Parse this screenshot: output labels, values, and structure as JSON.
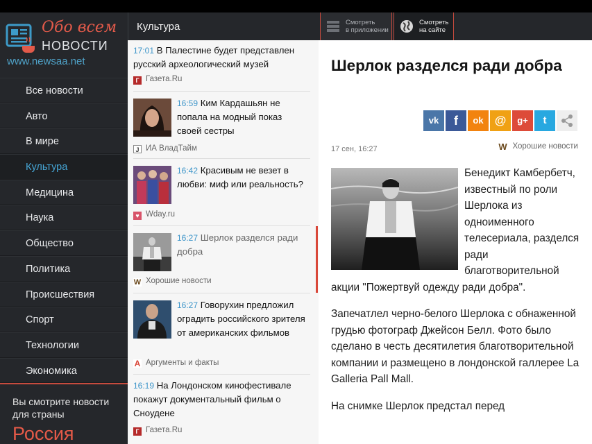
{
  "logo": {
    "line1": "Обо всем",
    "line2": "НОВОСТИ",
    "url": "www.newsaa.net"
  },
  "nav": {
    "items": [
      "Все новости",
      "Авто",
      "В мире",
      "Культура",
      "Медицина",
      "Наука",
      "Общество",
      "Политика",
      "Происшествия",
      "Спорт",
      "Технологии",
      "Экономика"
    ],
    "active": "Культура"
  },
  "country": {
    "note": "Вы смотрите новости для страны",
    "name": "Россия"
  },
  "middle": {
    "header": "Культура"
  },
  "feed": [
    {
      "time": "17:01",
      "title": "В Палестине будет представлен русский археологический музей",
      "source": "Газета.Ru",
      "source_icon": "gazeta-ru-icon",
      "thumb": false
    },
    {
      "time": "16:59",
      "title": "Ким Кардашьян не попала на модный показ своей сестры",
      "source": "ИА ВладТайм",
      "source_icon": "vladtime-icon",
      "thumb": true
    },
    {
      "time": "16:42",
      "title": "Красивым не везет в любви: миф или реальность?",
      "source": "Wday.ru",
      "source_icon": "wday-icon",
      "thumb": true
    },
    {
      "time": "16:27",
      "title": "Шерлок разделся ради добра",
      "source": "Хорошие новости",
      "source_icon": "good-news-icon",
      "thumb": true,
      "current": true
    },
    {
      "time": "16:27",
      "title": "Говорухин предложил оградить российского зрителя от американских фильмов",
      "source": "Аргументы и факты",
      "source_icon": "aif-icon",
      "thumb": true
    },
    {
      "time": "16:19",
      "title": "На Лондонском кинофестивале покажут документальный фильм о Сноудене",
      "source": "Газета.Ru",
      "source_icon": "gazeta-ru-icon",
      "thumb": false
    }
  ],
  "header_buttons": {
    "app": {
      "line1": "Смотреть",
      "line2": "в приложении"
    },
    "site": {
      "line1": "Смотреть",
      "line2": "на сайте"
    }
  },
  "article": {
    "title": "Шерлок разделся ради добра",
    "date": "17 сен, 16:27",
    "source": "Хорошие новости",
    "paragraphs": [
      "Бенедикт Камбербетч, известный по роли Шерлока из одноименного телесериала, разделся ради благотворительной акции \"Пожертвуй одежду ради добра\".",
      "Запечатлел черно-белого Шерлока с обнаженной грудью фотограф Джейсон Белл. Фото было сделано в честь десятилетия благотворительной компании и размещено в лондонской галлерее La Galleria Pall Mall.",
      "На снимке Шерлок предстал перед"
    ]
  },
  "share": [
    {
      "name": "vk",
      "label": "vk",
      "color": "#4a76a8"
    },
    {
      "name": "facebook",
      "label": "f",
      "color": "#3b5998"
    },
    {
      "name": "odnoklassniki",
      "label": "ok",
      "color": "#f2830f"
    },
    {
      "name": "mailru",
      "label": "@",
      "color": "#f0a114"
    },
    {
      "name": "googleplus",
      "label": "g+",
      "color": "#dd4b39"
    },
    {
      "name": "twitter",
      "label": "t",
      "color": "#28a8e0"
    },
    {
      "name": "share",
      "label": "<",
      "color": "#eeeeee"
    }
  ],
  "colors": {
    "accent_red": "#e25a4a",
    "link_blue": "#3d95c9",
    "sidebar_bg": "#25272b"
  }
}
